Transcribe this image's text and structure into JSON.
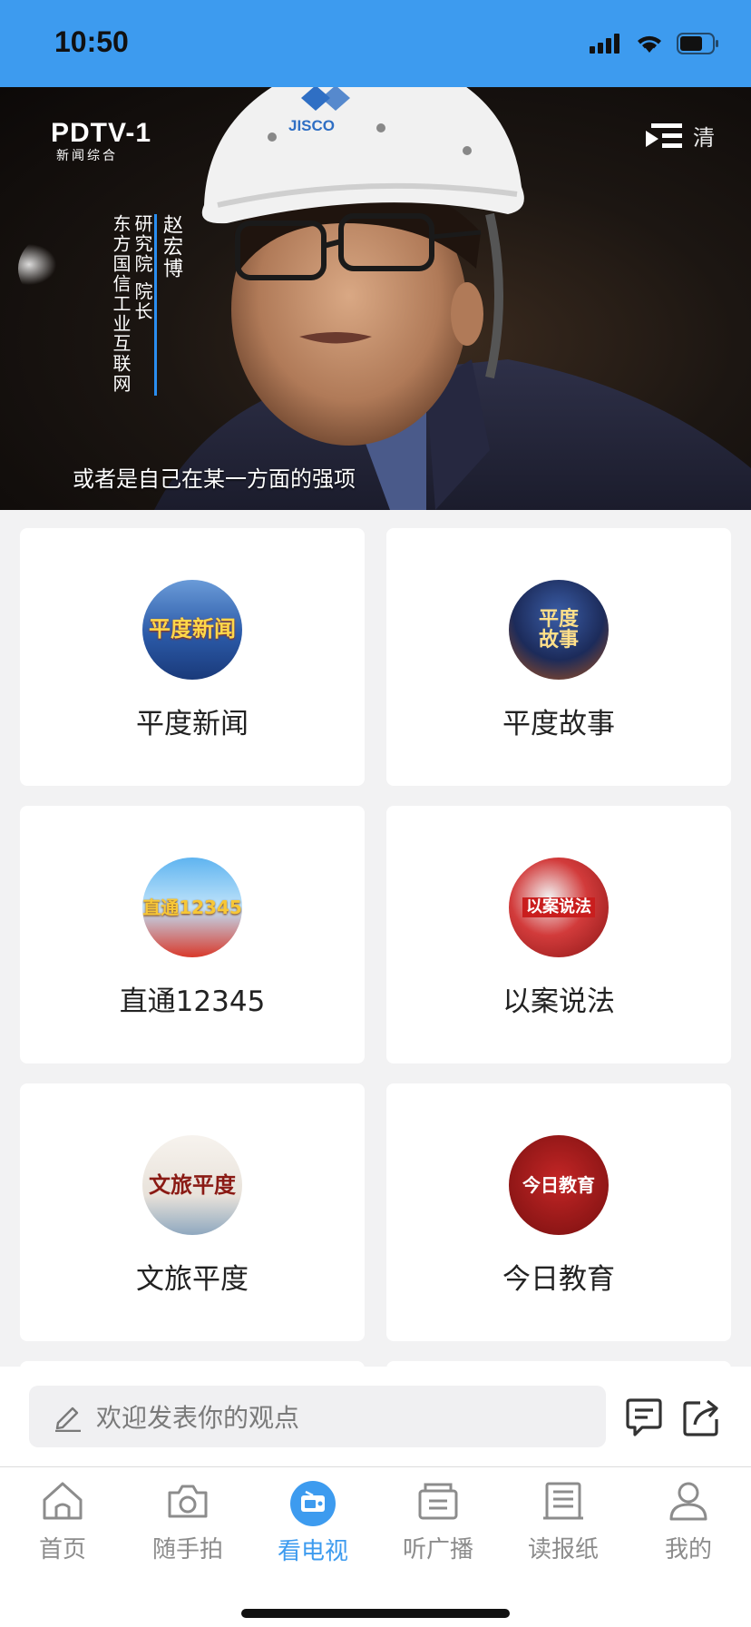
{
  "status": {
    "time": "10:50"
  },
  "video": {
    "channel_name": "PDTV-1",
    "channel_sub": "新闻综合",
    "quality_label": "清",
    "person_name": "赵宏博",
    "person_title_1": "研究院 院长",
    "person_org": "东方国信工业互联网",
    "helmet_text": "JISCO",
    "subtitle": "或者是自己在某一方面的强项"
  },
  "programs": [
    {
      "label": "平度新闻",
      "thumb_text": "平度新闻"
    },
    {
      "label": "平度故事",
      "thumb_text": "平度故事"
    },
    {
      "label": "直通12345",
      "thumb_text": "直通12345"
    },
    {
      "label": "以案说法",
      "thumb_text": "以案说法"
    },
    {
      "label": "文旅平度",
      "thumb_text": "文旅平度"
    },
    {
      "label": "今日教育",
      "thumb_text": "今日教育"
    }
  ],
  "comment": {
    "placeholder": "欢迎发表你的观点"
  },
  "tabs": [
    {
      "label": "首页",
      "icon": "home-icon"
    },
    {
      "label": "随手拍",
      "icon": "camera-icon"
    },
    {
      "label": "看电视",
      "icon": "tv-icon",
      "active": true
    },
    {
      "label": "听广播",
      "icon": "radio-icon"
    },
    {
      "label": "读报纸",
      "icon": "newspaper-icon"
    },
    {
      "label": "我的",
      "icon": "user-icon"
    }
  ],
  "colors": {
    "accent": "#3d9bef",
    "background": "#f2f2f3"
  }
}
